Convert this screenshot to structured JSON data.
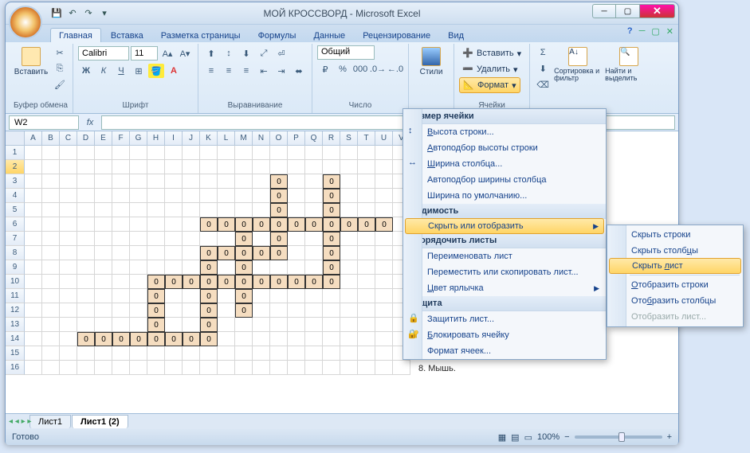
{
  "title": "МОЙ КРОССВОРД - Microsoft Excel",
  "qat": {
    "save": "💾",
    "undo": "↶",
    "redo": "↷"
  },
  "tabs": [
    "Главная",
    "Вставка",
    "Разметка страницы",
    "Формулы",
    "Данные",
    "Рецензирование",
    "Вид"
  ],
  "active_tab": 0,
  "ribbon": {
    "clipboard": {
      "paste": "Вставить",
      "label": "Буфер обмена"
    },
    "font": {
      "name": "Calibri",
      "size": "11",
      "label": "Шрифт"
    },
    "align": {
      "label": "Выравнивание"
    },
    "number": {
      "format": "Общий",
      "label": "Число"
    },
    "styles": {
      "label": "Стили"
    },
    "cells": {
      "insert": "Вставить",
      "delete": "Удалить",
      "format": "Формат",
      "label": "Ячейки"
    },
    "editing": {
      "sort": "Сортировка и фильтр",
      "find": "Найти и выделить"
    },
    "sigma": "Σ"
  },
  "namebox": "W2",
  "columns": [
    "A",
    "B",
    "C",
    "D",
    "E",
    "F",
    "G",
    "H",
    "I",
    "J",
    "K",
    "L",
    "M",
    "N",
    "O",
    "P",
    "Q",
    "R",
    "S",
    "T",
    "U",
    "V"
  ],
  "row_count": 16,
  "selected_row": 2,
  "crossword_cells": [
    [
      3,
      15
    ],
    [
      3,
      18
    ],
    [
      4,
      15
    ],
    [
      4,
      18
    ],
    [
      5,
      15
    ],
    [
      5,
      18
    ],
    [
      6,
      11
    ],
    [
      6,
      12
    ],
    [
      6,
      13
    ],
    [
      6,
      14
    ],
    [
      6,
      15
    ],
    [
      6,
      16
    ],
    [
      6,
      17
    ],
    [
      6,
      18
    ],
    [
      6,
      19
    ],
    [
      6,
      20
    ],
    [
      6,
      21
    ],
    [
      7,
      13
    ],
    [
      7,
      15
    ],
    [
      7,
      18
    ],
    [
      8,
      11
    ],
    [
      8,
      12
    ],
    [
      8,
      13
    ],
    [
      8,
      14
    ],
    [
      8,
      15
    ],
    [
      8,
      18
    ],
    [
      9,
      11
    ],
    [
      9,
      13
    ],
    [
      9,
      18
    ],
    [
      10,
      8
    ],
    [
      10,
      9
    ],
    [
      10,
      10
    ],
    [
      10,
      11
    ],
    [
      10,
      12
    ],
    [
      10,
      13
    ],
    [
      10,
      14
    ],
    [
      10,
      15
    ],
    [
      10,
      16
    ],
    [
      10,
      17
    ],
    [
      10,
      18
    ],
    [
      11,
      8
    ],
    [
      11,
      11
    ],
    [
      11,
      13
    ],
    [
      12,
      8
    ],
    [
      12,
      11
    ],
    [
      12,
      13
    ],
    [
      13,
      8
    ],
    [
      13,
      11
    ],
    [
      14,
      4
    ],
    [
      14,
      5
    ],
    [
      14,
      6
    ],
    [
      14,
      7
    ],
    [
      14,
      8
    ],
    [
      14,
      9
    ],
    [
      14,
      10
    ],
    [
      14,
      11
    ]
  ],
  "cell_value": "0",
  "sheet_tabs": [
    "Лист1",
    "Лист1 (2)"
  ],
  "active_sheet": 1,
  "status": "Готово",
  "zoom": "100%",
  "format_menu": {
    "sec1": "Размер ячейки",
    "row_height": "Высота строки...",
    "autofit_row": "Автоподбор высоты строки",
    "col_width": "Ширина столбца...",
    "autofit_col": "Автоподбор ширины столбца",
    "default_width": "Ширина по умолчанию...",
    "sec2": "Видимость",
    "hide_show": "Скрыть или отобразить",
    "sec3": "Упорядочить листы",
    "rename": "Переименовать лист",
    "move": "Переместить или скопировать лист...",
    "tab_color": "Цвет ярлычка",
    "sec4": "Защита",
    "protect": "Защитить лист...",
    "lock": "Блокировать ячейку",
    "format_cells": "Формат ячеек..."
  },
  "submenu": {
    "hide_rows": "Скрыть строки",
    "hide_cols": "Скрыть столбцы",
    "hide_sheet": "Скрыть лист",
    "show_rows": "Отобразить строки",
    "show_cols": "Отобразить столбцы",
    "show_sheet": "Отобразить лист..."
  },
  "hint": "8. Мышь."
}
